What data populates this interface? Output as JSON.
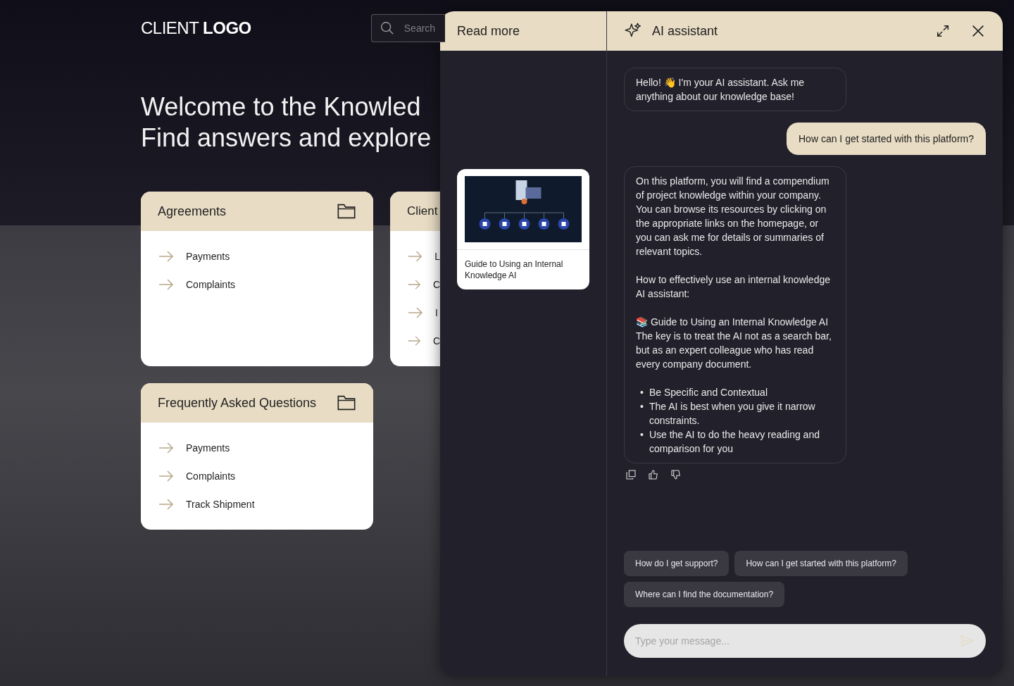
{
  "header": {
    "logo": "CLIENT **LOGO**",
    "search": {
      "placeholder": "Search"
    }
  },
  "hero": {
    "lines": [
      "Welcome to the Knowled",
      "Find answers and explore"
    ]
  },
  "categories": [
    {
      "title": "Agreements",
      "items": [
        "Payments",
        "Complaints"
      ]
    },
    {
      "title": "Client",
      "items": [
        "L",
        "C",
        "I",
        "C"
      ]
    },
    {
      "title": "Frequently Asked Questions",
      "items": [
        "Payments",
        "Complaints",
        "Track Shipment"
      ]
    }
  ],
  "panel": {
    "read_more": {
      "title": "Read more",
      "sources": [
        {
          "title": "Guide to Using an Internal Knowledge AI"
        }
      ]
    },
    "assistant": {
      "title": "AI assistant",
      "messages": [
        {
          "kind": "assistant",
          "actions": false,
          "blocks": [
            {
              "kind": "paragraph",
              "lines": [
                "Hello! 👋 I'm your AI assistant. Ask me anything about our knowledge base!"
              ]
            }
          ]
        },
        {
          "kind": "user",
          "actions": false,
          "blocks": [
            {
              "kind": "paragraph",
              "lines": [
                "How can I get started with this platform?"
              ]
            }
          ]
        },
        {
          "kind": "assistant",
          "actions": true,
          "blocks": [
            {
              "kind": "paragraph",
              "lines": [
                "On this platform, you will find a compendium of project knowledge within your company. You can browse its resources by clicking on the appropriate links on the homepage, or you can ask me for details or summaries of relevant topics."
              ]
            },
            {
              "kind": "paragraph",
              "lines": [
                "How to effectively use an internal knowledge AI assistant:"
              ]
            },
            {
              "kind": "paragraph",
              "lines": [
                "📚 Guide to Using an Internal Knowledge AI",
                "The key is to treat the AI not as a search bar, but as an expert colleague who has read every company document."
              ]
            },
            {
              "kind": "list",
              "items": [
                {
                  "marker": "•",
                  "text": "Be Specific and Contextual"
                },
                {
                  "marker": "•",
                  "text": "The AI is best when you give it narrow constraints."
                },
                {
                  "marker": "•",
                  "text": "Use the AI to do the heavy reading and comparison for you"
                }
              ]
            }
          ]
        }
      ],
      "suggestions": [
        "How do I get support?",
        "How can I get started with this platform?",
        "Where can I find the documentation?"
      ],
      "input": {
        "placeholder": "Type your message..."
      }
    }
  }
}
